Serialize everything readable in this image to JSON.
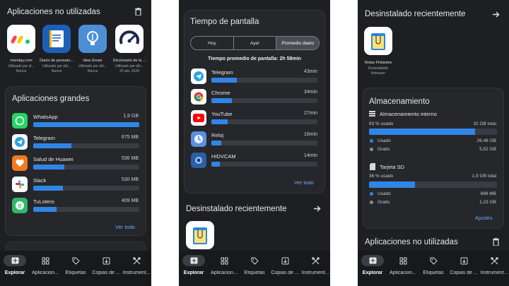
{
  "colors": {
    "accent": "#2f86e6",
    "background": "#1e1f22",
    "card": "#26272b",
    "link": "#6ea8ff"
  },
  "screen1": {
    "unused_title": "Aplicaciones no utilizadas",
    "unused_apps": [
      {
        "name": "monday.com",
        "sub": "Utilizado por úl...",
        "date": "Nunca"
      },
      {
        "name": "Diario de pensam...",
        "sub": "Utilizado por últi...",
        "date": "Nunca"
      },
      {
        "name": "Idea Growr",
        "sub": "Utilizado por últi...",
        "date": "Nunca"
      },
      {
        "name": "Diccionario de la ...",
        "sub": "Utilizado por últi...",
        "date": "20 abr. 2024"
      }
    ],
    "large_title": "Aplicaciones grandes",
    "large_apps": [
      {
        "name": "WhatsApp",
        "size": "1,9 GB",
        "fraction": 1.0
      },
      {
        "name": "Telegram",
        "size": "675 MB",
        "fraction": 0.36
      },
      {
        "name": "Salud de Huawei",
        "size": "536 MB",
        "fraction": 0.29
      },
      {
        "name": "Slack",
        "size": "530 MB",
        "fraction": 0.28
      },
      {
        "name": "TuLotero",
        "size": "409 MB",
        "fraction": 0.22
      }
    ],
    "view_all": "Ver todo"
  },
  "screen2": {
    "title": "Tiempo de pantalla",
    "tabs": [
      "Hoy",
      "Ayer",
      "Promedio diario"
    ],
    "selected_tab": 2,
    "average_label": "Tiempo promedio de pantalla: 2h 58min",
    "apps": [
      {
        "name": "Telegram",
        "time": "43min",
        "fraction": 0.24
      },
      {
        "name": "Chrome",
        "time": "34min",
        "fraction": 0.19
      },
      {
        "name": "YouTube",
        "time": "27min",
        "fraction": 0.15
      },
      {
        "name": "Reloj",
        "time": "16min",
        "fraction": 0.09
      },
      {
        "name": "HIDVCAM",
        "time": "14min",
        "fraction": 0.08
      }
    ],
    "view_all": "Ver todo",
    "uninstalled_title": "Desinstalado recientemente"
  },
  "screen3": {
    "uninstalled_title": "Desinstalado recientemente",
    "uninstalled_app": {
      "name": "Notas Flotantes",
      "status": "Desinstalado",
      "date": "Anteayer"
    },
    "storage_title": "Almacenamiento",
    "internal": {
      "label": "Almacenamiento interno",
      "used_pct": "83 % usado",
      "total": "32 GB total",
      "fraction": 0.83,
      "used_label": "Usado",
      "used_value": "26,48 GB",
      "free_label": "Gratis",
      "free_value": "5,52 GB"
    },
    "sd": {
      "label": "Tarjeta SD",
      "used_pct": "36 % usado",
      "total": "1,9 GB total",
      "fraction": 0.36,
      "used_label": "Usado",
      "used_value": "688 MB",
      "free_label": "Gratis",
      "free_value": "1,23 GB"
    },
    "settings": "Ajustes",
    "unused_title": "Aplicaciones no utilizadas"
  },
  "nav": [
    "Explorar",
    "Aplicacion...",
    "Etiquetas",
    "Copias de ...",
    "Instrument..."
  ]
}
